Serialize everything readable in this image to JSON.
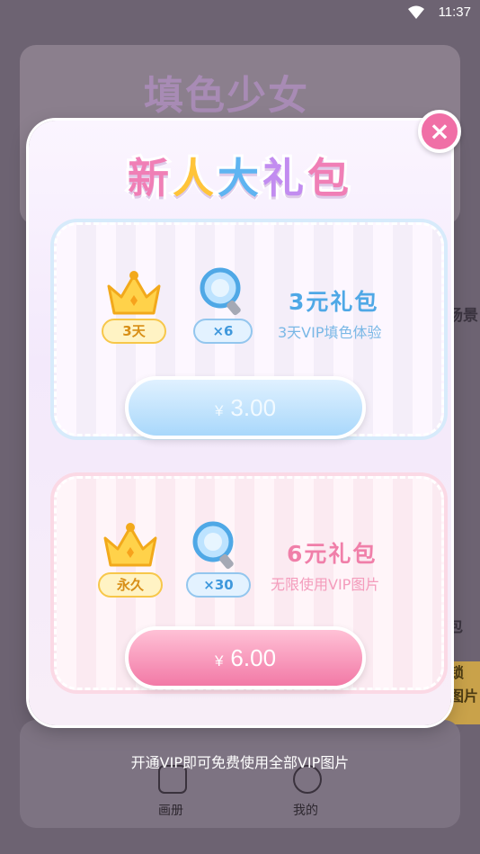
{
  "status_bar": {
    "time": "11:37",
    "wifi_icon": "wifi-icon"
  },
  "background": {
    "app_title": "填色少女",
    "side_label_1": "场景",
    "side_label_2": "包",
    "unlock_1": "锁",
    "unlock_2": "图片",
    "nav_album": "画册",
    "nav_mine": "我的"
  },
  "modal": {
    "title_chars": [
      "新",
      "人",
      "大",
      "礼",
      "包"
    ],
    "close_icon": "close-icon",
    "packs": [
      {
        "theme": "blue",
        "crown_badge": "3天",
        "magnifier_badge": "×6",
        "name": "3元礼包",
        "description": "3天VIP填色体验",
        "currency": "¥",
        "price": "3.00",
        "name_color": "#4fa8e6",
        "desc_color": "#7ab8e6"
      },
      {
        "theme": "pink",
        "crown_badge": "永久",
        "magnifier_badge": "×30",
        "name": "6元礼包",
        "description": "无限使用VIP图片",
        "currency": "¥",
        "price": "6.00",
        "name_color": "#f07fa9",
        "desc_color": "#f49cbc"
      }
    ]
  },
  "footer_note": "开通VIP即可免费使用全部VIP图片"
}
